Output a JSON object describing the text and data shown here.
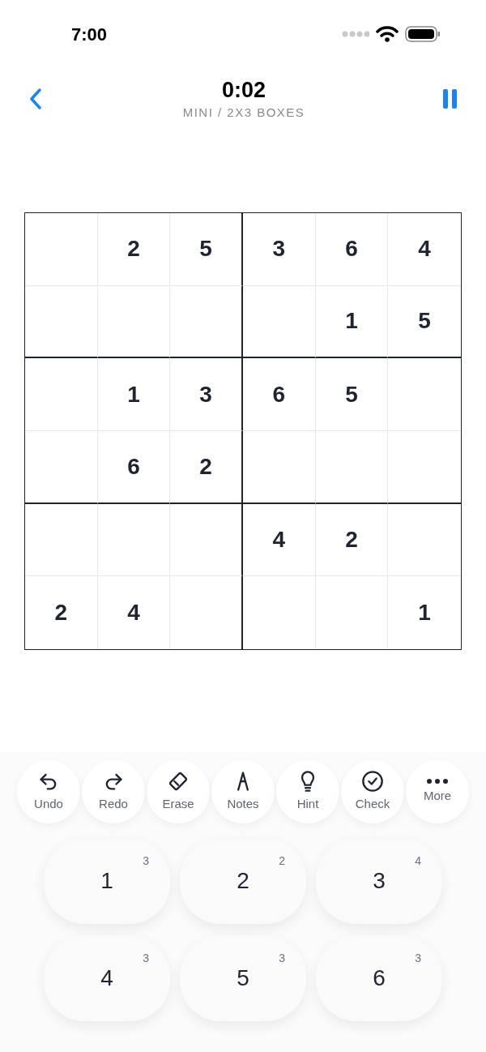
{
  "status_bar": {
    "time": "7:00"
  },
  "header": {
    "timer": "0:02",
    "subtitle": "MINI / 2X3 BOXES"
  },
  "grid": {
    "rows": [
      [
        null,
        "2",
        "5",
        "3",
        "6",
        "4"
      ],
      [
        null,
        null,
        null,
        null,
        "1",
        "5"
      ],
      [
        null,
        "1",
        "3",
        "6",
        "5",
        null
      ],
      [
        null,
        "6",
        "2",
        null,
        null,
        null
      ],
      [
        null,
        null,
        null,
        "4",
        "2",
        null
      ],
      [
        "2",
        "4",
        null,
        null,
        null,
        "1"
      ]
    ]
  },
  "tools": [
    {
      "kind": "undo",
      "label": "Undo"
    },
    {
      "kind": "redo",
      "label": "Redo"
    },
    {
      "kind": "erase",
      "label": "Erase"
    },
    {
      "kind": "notes",
      "label": "Notes"
    },
    {
      "kind": "hint",
      "label": "Hint"
    },
    {
      "kind": "check",
      "label": "Check"
    },
    {
      "kind": "more",
      "label": "More"
    }
  ],
  "numbers": [
    {
      "digit": "1",
      "remaining": "3"
    },
    {
      "digit": "2",
      "remaining": "2"
    },
    {
      "digit": "3",
      "remaining": "4"
    },
    {
      "digit": "4",
      "remaining": "3"
    },
    {
      "digit": "5",
      "remaining": "3"
    },
    {
      "digit": "6",
      "remaining": "3"
    }
  ]
}
